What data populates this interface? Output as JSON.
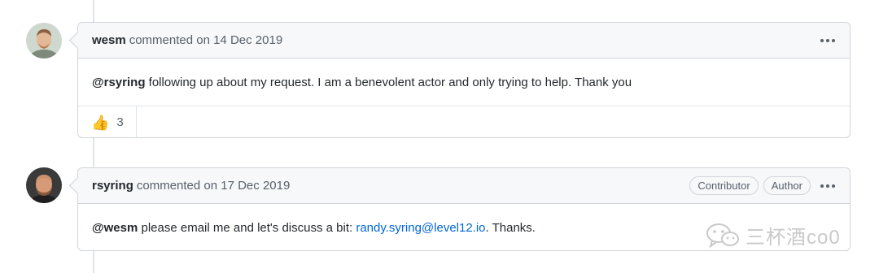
{
  "comments": [
    {
      "author": "wesm",
      "meta": "commented on 14 Dec 2019",
      "mention": "@rsyring",
      "text": " following up about my request. I am a benevolent actor and only trying to help. Thank you",
      "reactions": [
        {
          "icon": "thumbs-up-icon",
          "emoji": "👍",
          "count": "3"
        }
      ]
    },
    {
      "author": "rsyring",
      "meta": "commented on 17 Dec 2019",
      "badges": [
        "Contributor",
        "Author"
      ],
      "mention": "@wesm",
      "text_before": " please email me and let's discuss a bit: ",
      "link": "randy.syring@level12.io",
      "text_after": ". Thanks."
    }
  ],
  "watermark": "三杯酒co0"
}
